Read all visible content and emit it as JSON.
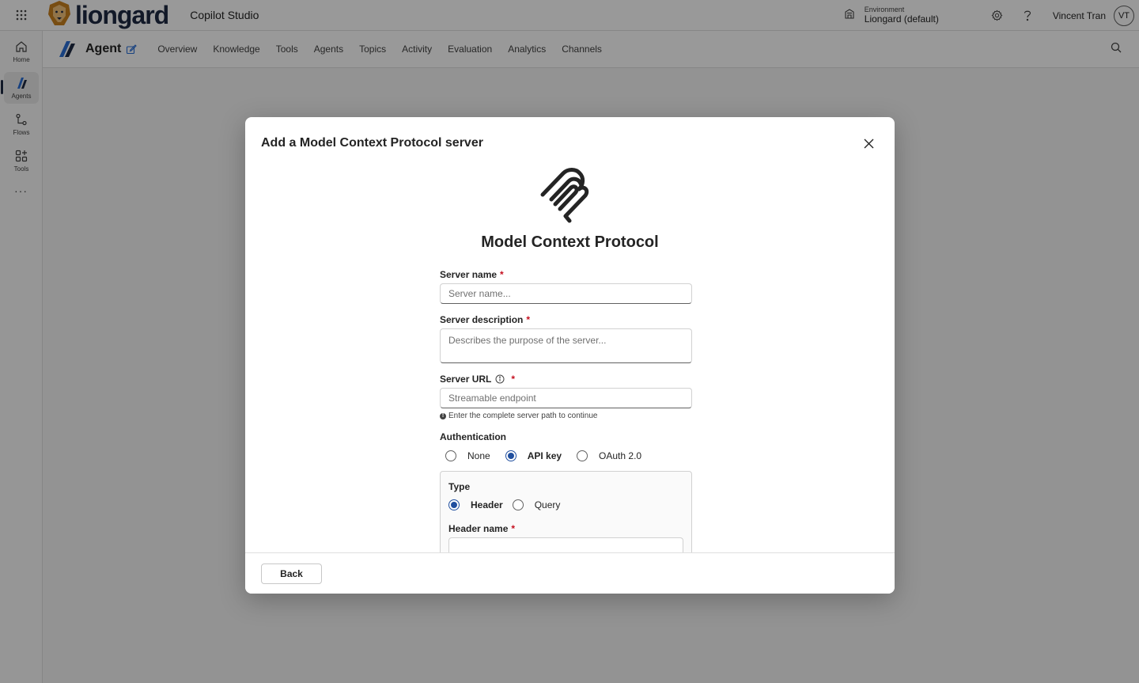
{
  "topbar": {
    "brand": "liongard",
    "product": "Copilot Studio",
    "environment_label": "Environment",
    "environment_value": "Liongard (default)",
    "user_name": "Vincent Tran",
    "user_initials": "VT",
    "icons": [
      "app-launcher-icon",
      "environment-icon",
      "settings-icon",
      "help-icon"
    ]
  },
  "rail": {
    "items": [
      {
        "label": "Home",
        "icon": "home-icon"
      },
      {
        "label": "Agents",
        "icon": "agents-icon",
        "active": true
      },
      {
        "label": "Flows",
        "icon": "flows-icon"
      },
      {
        "label": "Tools",
        "icon": "tools-icon"
      }
    ],
    "more": "···"
  },
  "agentbar": {
    "title": "Agent",
    "tabs": [
      "Overview",
      "Knowledge",
      "Tools",
      "Agents",
      "Topics",
      "Activity",
      "Evaluation",
      "Analytics",
      "Channels"
    ]
  },
  "dialog": {
    "title": "Add a Model Context Protocol server",
    "heading": "Model Context Protocol",
    "server_name": {
      "label": "Server name",
      "required": "*",
      "placeholder": "Server name..."
    },
    "server_description": {
      "label": "Server description",
      "required": "*",
      "placeholder": "Describes the purpose of the server..."
    },
    "server_url": {
      "label": "Server URL",
      "required": "*",
      "placeholder": "Streamable endpoint",
      "hint": "Enter the complete server path to continue"
    },
    "authentication": {
      "label": "Authentication",
      "options": [
        "None",
        "API key",
        "OAuth 2.0"
      ],
      "selected": "API key"
    },
    "type": {
      "label": "Type",
      "options": [
        "Header",
        "Query"
      ],
      "selected": "Header"
    },
    "header_name": {
      "label": "Header name",
      "required": "*",
      "value": ""
    },
    "back_label": "Back"
  },
  "colors": {
    "accent": "#1f4e9e",
    "required": "#c50f1f",
    "brand": "#1f2a44"
  }
}
